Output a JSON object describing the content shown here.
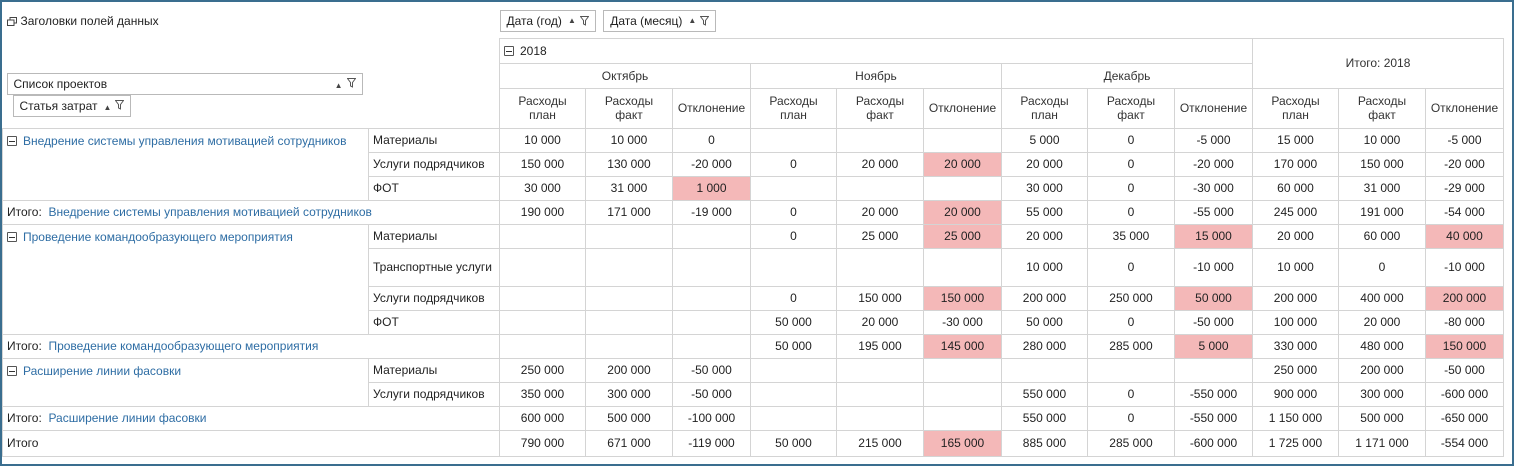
{
  "header": {
    "data_headers_label": "Заголовки полей данных",
    "filter_year": "Дата (год)",
    "filter_month": "Дата (месяц)",
    "project_list_field": "Список проектов",
    "cost_item_field": "Статья затрат",
    "year": "2018",
    "months": [
      "Октябрь",
      "Ноябрь",
      "Декабрь"
    ],
    "grand_total_header": "Итого: 2018",
    "plan": "Расходы план",
    "fact": "Расходы факт",
    "deviation": "Отклонение",
    "plan_wrapped": "Расходы\nплан",
    "fact_wrapped": "Расходы\nфакт"
  },
  "labels": {
    "total_prefix": "Итого:",
    "grand_total": "Итого"
  },
  "colors": {
    "frame": "#3a6e8f",
    "link": "#2e6da4",
    "highlight": "#f4b8b8",
    "grid": "#d4d4d4"
  },
  "projects": [
    {
      "name": "Внедрение системы управления мотивацией сотрудников",
      "rows": [
        {
          "item": "Материалы",
          "v": [
            "10 000",
            "10 000",
            "0",
            "",
            "",
            "",
            "5 000",
            "0",
            "-5 000",
            "15 000",
            "10 000",
            "-5 000"
          ]
        },
        {
          "item": "Услуги подрядчиков",
          "v": [
            "150 000",
            "130 000",
            "-20 000",
            "0",
            "20 000",
            "20 000",
            "20 000",
            "0",
            "-20 000",
            "170 000",
            "150 000",
            "-20 000"
          ]
        },
        {
          "item": "ФОТ",
          "v": [
            "30 000",
            "31 000",
            "1 000",
            "",
            "",
            "",
            "30 000",
            "0",
            "-30 000",
            "60 000",
            "31 000",
            "-29 000"
          ]
        }
      ],
      "total": [
        "190 000",
        "171 000",
        "-19 000",
        "0",
        "20 000",
        "20 000",
        "55 000",
        "0",
        "-55 000",
        "245 000",
        "191 000",
        "-54 000"
      ]
    },
    {
      "name": "Проведение командообразующего мероприятия",
      "rows": [
        {
          "item": "Материалы",
          "v": [
            "",
            "",
            "",
            "0",
            "25 000",
            "25 000",
            "20 000",
            "35 000",
            "15 000",
            "20 000",
            "60 000",
            "40 000"
          ]
        },
        {
          "item": "Транспортные услуги",
          "v": [
            "",
            "",
            "",
            "",
            "",
            "",
            "10 000",
            "0",
            "-10 000",
            "10 000",
            "0",
            "-10 000"
          ]
        },
        {
          "item": "Услуги подрядчиков",
          "v": [
            "",
            "",
            "",
            "0",
            "150 000",
            "150 000",
            "200 000",
            "250 000",
            "50 000",
            "200 000",
            "400 000",
            "200 000"
          ]
        },
        {
          "item": "ФОТ",
          "v": [
            "",
            "",
            "",
            "50 000",
            "20 000",
            "-30 000",
            "50 000",
            "0",
            "-50 000",
            "100 000",
            "20 000",
            "-80 000"
          ]
        }
      ],
      "total": [
        "",
        "",
        "",
        "50 000",
        "195 000",
        "145 000",
        "280 000",
        "285 000",
        "5 000",
        "330 000",
        "480 000",
        "150 000"
      ]
    },
    {
      "name": "Расширение линии фасовки",
      "rows": [
        {
          "item": "Материалы",
          "v": [
            "250 000",
            "200 000",
            "-50 000",
            "",
            "",
            "",
            "",
            "",
            "",
            "250 000",
            "200 000",
            "-50 000"
          ]
        },
        {
          "item": "Услуги подрядчиков",
          "v": [
            "350 000",
            "300 000",
            "-50 000",
            "",
            "",
            "",
            "550 000",
            "0",
            "-550 000",
            "900 000",
            "300 000",
            "-600 000"
          ]
        }
      ],
      "total": [
        "600 000",
        "500 000",
        "-100 000",
        "",
        "",
        "",
        "550 000",
        "0",
        "-550 000",
        "1 150 000",
        "500 000",
        "-650 000"
      ]
    }
  ],
  "grand_total_values": [
    "790 000",
    "671 000",
    "-119 000",
    "50 000",
    "215 000",
    "165 000",
    "885 000",
    "285 000",
    "-600 000",
    "1 725 000",
    "1 171 000",
    "-554 000"
  ]
}
